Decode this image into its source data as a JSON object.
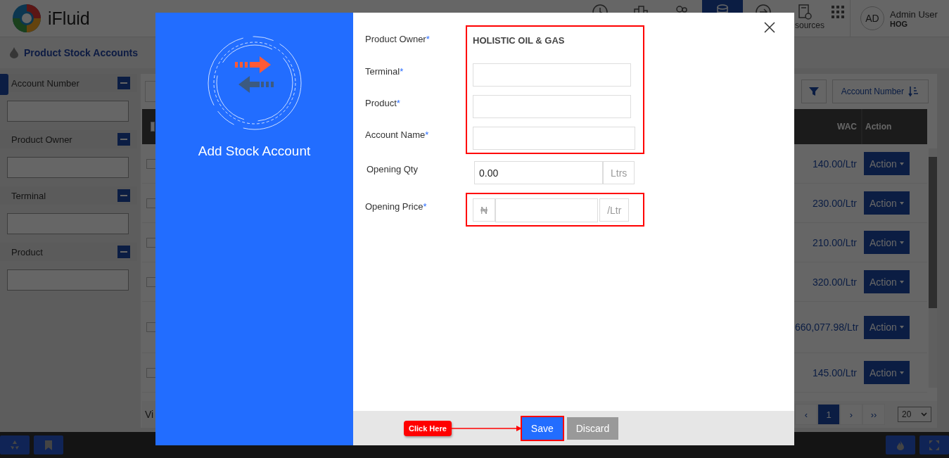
{
  "app": {
    "logo_text": "iFluid",
    "page_title": "Product Stock Accounts",
    "nav": [
      {
        "kind": "clock",
        "selected": false
      },
      {
        "kind": "buildings",
        "selected": false
      },
      {
        "kind": "people",
        "selected": false
      },
      {
        "kind": "coins",
        "selected": true
      },
      {
        "kind": "exit",
        "selected": false
      },
      {
        "kind": "document",
        "selected": false,
        "label": "sources"
      },
      {
        "kind": "apps",
        "selected": false
      }
    ],
    "user": {
      "initials": "AD",
      "name": "Admin User",
      "org": "HOG"
    }
  },
  "filters": [
    {
      "label": "Account Number"
    },
    {
      "label": "Product Owner"
    },
    {
      "label": "Terminal"
    },
    {
      "label": "Product"
    }
  ],
  "toolbar": {
    "sort_label": "Account Number"
  },
  "table": {
    "columns": [
      "WAC",
      "Action"
    ],
    "select_all_checked": false,
    "rows": [
      {
        "checked": false,
        "wac": "140.00/Ltr",
        "action": "Action"
      },
      {
        "checked": false,
        "wac": "230.00/Ltr",
        "action": "Action"
      },
      {
        "checked": false,
        "wac": "210.00/Ltr",
        "action": "Action"
      },
      {
        "checked": false,
        "wac": "320.00/Ltr",
        "action": "Action"
      },
      {
        "checked": false,
        "wac": "660,077.98/Ltr",
        "action": "Action"
      },
      {
        "checked": false,
        "wac": "145.00/Ltr",
        "action": "Action"
      }
    ]
  },
  "pagination": {
    "partial_text": "Vi",
    "pages": [
      {
        "label": "‹",
        "selected": false
      },
      {
        "label": "1",
        "selected": true
      },
      {
        "label": "›",
        "selected": false
      },
      {
        "label": "››",
        "selected": false
      }
    ],
    "page_size": "20"
  },
  "modal": {
    "title": "Add Stock Account",
    "groups": [
      {
        "highlighted": true,
        "fields": [
          {
            "kind": "text",
            "label": "Product Owner",
            "mark": "*",
            "value": "HOLISTIC OIL & GAS"
          },
          {
            "kind": "input",
            "label": "Terminal",
            "mark": "*"
          },
          {
            "kind": "input",
            "label": "Product",
            "mark": "*"
          },
          {
            "kind": "input_wide",
            "label": "Account Name",
            "mark": "*"
          }
        ]
      },
      {
        "highlighted": false,
        "fields": [
          {
            "kind": "suffix",
            "label": "Opening Qty",
            "value": "0.00",
            "suffix": "Ltrs"
          }
        ]
      },
      {
        "highlighted": true,
        "fields": [
          {
            "kind": "prefix_suffix",
            "label": "Opening Price",
            "mark": "*",
            "prefix": "₦",
            "suffix": "/Ltr"
          }
        ]
      }
    ],
    "callout": "Click Here",
    "buttons": [
      {
        "kind": "primary",
        "label": "Save",
        "highlighted": true
      },
      {
        "kind": "secondary",
        "label": "Discard",
        "highlighted": false
      }
    ]
  }
}
